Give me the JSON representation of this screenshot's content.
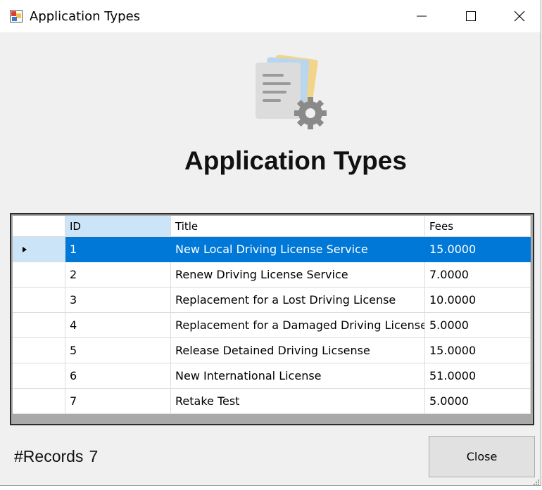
{
  "window": {
    "title": "Application Types"
  },
  "header": {
    "title": "Application Types"
  },
  "grid": {
    "columns": [
      "ID",
      "Title",
      "Fees"
    ],
    "rows": [
      {
        "id": "1",
        "title": "New Local Driving License Service",
        "fees": "15.0000"
      },
      {
        "id": "2",
        "title": "Renew Driving License Service",
        "fees": "7.0000"
      },
      {
        "id": "3",
        "title": "Replacement for a Lost Driving License",
        "fees": "10.0000"
      },
      {
        "id": "4",
        "title": "Replacement for a Damaged Driving License",
        "fees": "5.0000"
      },
      {
        "id": "5",
        "title": "Release Detained Driving Licsense",
        "fees": "15.0000"
      },
      {
        "id": "6",
        "title": "New International License",
        "fees": "51.0000"
      },
      {
        "id": "7",
        "title": "Retake Test",
        "fees": "5.0000"
      }
    ],
    "selected_row": 0
  },
  "footer": {
    "records_label": "#Records",
    "records_count": "7",
    "close_label": "Close"
  },
  "icons": {
    "app": "app-icon",
    "header": "document-settings-icon",
    "row_pointer": "triangle-right-icon"
  }
}
